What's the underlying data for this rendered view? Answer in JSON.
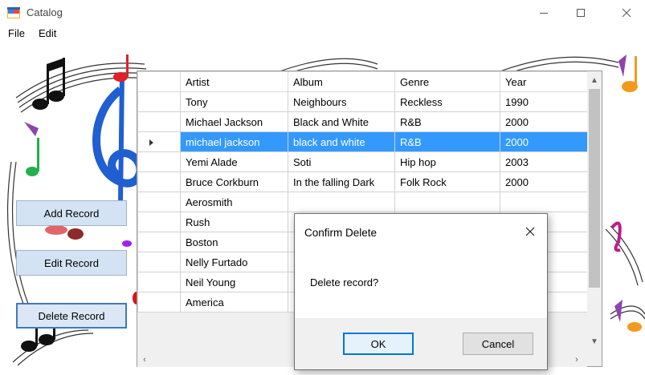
{
  "window": {
    "title": "Catalog",
    "icon": "app-window-icon",
    "controls": [
      "minimize-icon",
      "maximize-icon",
      "close-icon"
    ]
  },
  "menu": {
    "file": "File",
    "edit": "Edit"
  },
  "buttons": {
    "add": "Add Record",
    "edit": "Edit Record",
    "delete": "Delete Record"
  },
  "grid": {
    "columns": [
      "Artist",
      "Album",
      "Genre",
      "Year"
    ],
    "selected_row": 2,
    "rows": [
      {
        "artist": "Tony",
        "album": "Neighbours",
        "genre": "Reckless",
        "year": "1990"
      },
      {
        "artist": "Michael Jackson",
        "album": "Black and White",
        "genre": "R&B",
        "year": "2000"
      },
      {
        "artist": "michael jackson",
        "album": "black and white",
        "genre": "R&B",
        "year": "2000"
      },
      {
        "artist": "Yemi Alade",
        "album": "Soti",
        "genre": "Hip hop",
        "year": "2003"
      },
      {
        "artist": "Bruce Corkburn",
        "album": "In the falling Dark",
        "genre": "Folk Rock",
        "year": "2000"
      },
      {
        "artist": "Aerosmith",
        "album": "",
        "genre": "",
        "year": ""
      },
      {
        "artist": "Rush",
        "album": "",
        "genre": "",
        "year": ""
      },
      {
        "artist": "Boston",
        "album": "",
        "genre": "",
        "year": ""
      },
      {
        "artist": "Nelly Furtado",
        "album": "",
        "genre": "",
        "year": ""
      },
      {
        "artist": "Neil Young",
        "album": "",
        "genre": "",
        "year": ""
      },
      {
        "artist": "America",
        "album": "",
        "genre": "",
        "year": ""
      }
    ]
  },
  "dialog": {
    "title": "Confirm Delete",
    "message": "Delete record?",
    "ok": "OK",
    "cancel": "Cancel"
  },
  "colors": {
    "selection": "#3399ff",
    "button_bg": "#d3e3f3",
    "focus_border": "#0078d7"
  }
}
